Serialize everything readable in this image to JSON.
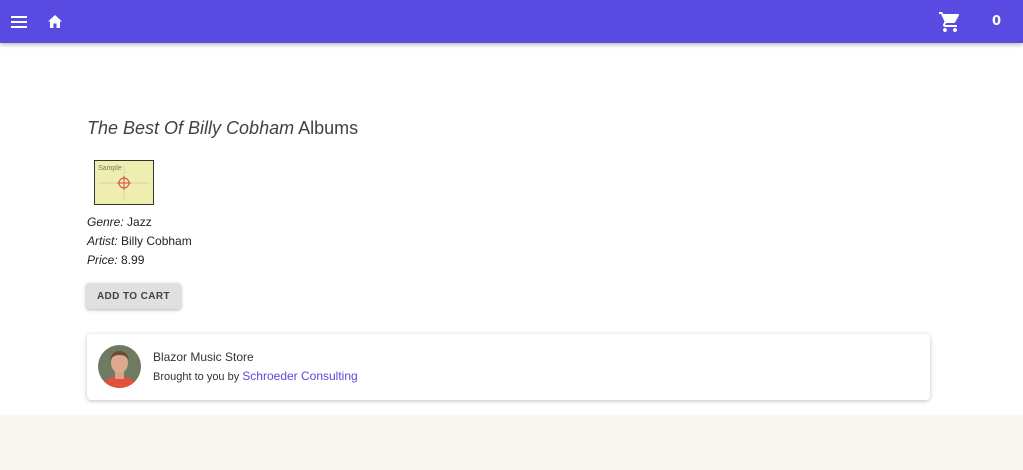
{
  "appbar": {
    "menu_icon": "menu-icon",
    "home_icon": "home-icon",
    "cart_icon": "cart-icon",
    "cart_count": "0",
    "color": "#594ae2"
  },
  "album": {
    "title": "The Best Of Billy Cobham",
    "title_suffix": "Albums",
    "cover_text": "Sample",
    "genre_label": "Genre:",
    "genre": "Jazz",
    "artist_label": "Artist:",
    "artist": "Billy Cobham",
    "price_label": "Price:",
    "price": "8.99",
    "add_to_cart": "ADD TO CART"
  },
  "footer_card": {
    "title": "Blazor Music Store",
    "subtitle_prefix": "Brought to you by",
    "link_text": "Schroeder Consulting",
    "link_color": "#594ae2"
  }
}
